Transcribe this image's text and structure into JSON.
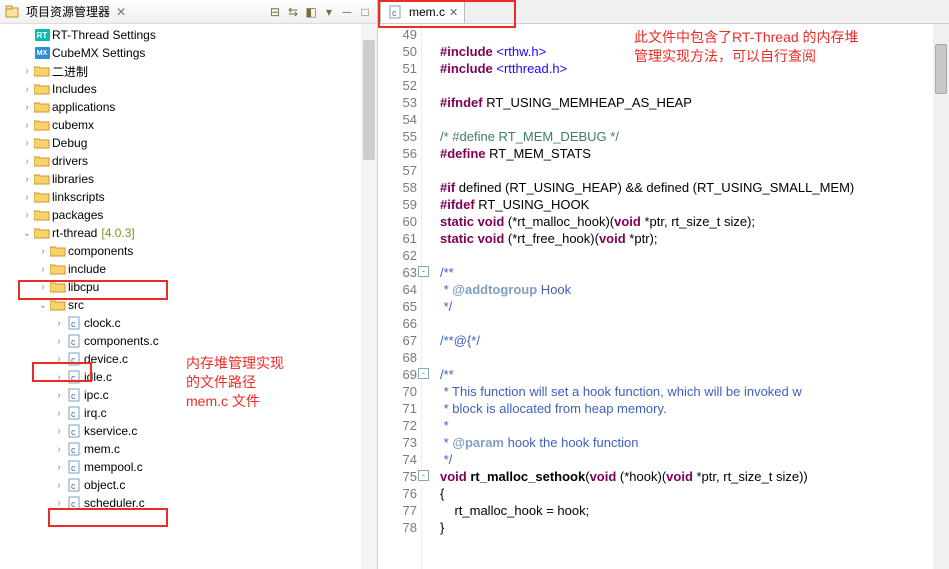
{
  "explorer": {
    "title": "项目资源管理器",
    "nodes": {
      "rt_settings": "RT-Thread Settings",
      "cubemx_settings": "CubeMX Settings",
      "binary": "二进制",
      "includes": "Includes",
      "applications": "applications",
      "cubemx": "cubemx",
      "debug": "Debug",
      "drivers": "drivers",
      "libraries": "libraries",
      "linkscripts": "linkscripts",
      "packages": "packages",
      "rtthread": "rt-thread",
      "rtthread_ver": "[4.0.3]",
      "components": "components",
      "include": "include",
      "libcpu": "libcpu",
      "src": "src",
      "clock": "clock.c",
      "componentsc": "components.c",
      "device": "device.c",
      "idle": "idle.c",
      "ipc": "ipc.c",
      "irq": "irq.c",
      "kservice": "kservice.c",
      "mem": "mem.c",
      "mempool": "mempool.c",
      "object": "object.c",
      "scheduler": "scheduler.c"
    }
  },
  "annot": {
    "tree_note_l1": "内存堆管理实现",
    "tree_note_l2": "的文件路径",
    "tree_note_l3": "mem.c 文件",
    "editor_note_l1": "此文件中包含了RT-Thread 的内存堆",
    "editor_note_l2": "管理实现方法，可以自行查阅"
  },
  "tab": {
    "filename": "mem.c"
  },
  "code": {
    "lines": [
      {
        "n": 49,
        "t": ""
      },
      {
        "n": 50,
        "pre": "#include",
        "arg": "<rthw.h>"
      },
      {
        "n": 51,
        "pre": "#include",
        "arg": "<rtthread.h>"
      },
      {
        "n": 52,
        "t": ""
      },
      {
        "n": 53,
        "pre": "#ifndef",
        "rest": " RT_USING_MEMHEAP_AS_HEAP"
      },
      {
        "n": 54,
        "t": ""
      },
      {
        "n": 55,
        "cmt": "/* #define RT_MEM_DEBUG */"
      },
      {
        "n": 56,
        "pre": "#define",
        "rest": " RT_MEM_STATS"
      },
      {
        "n": 57,
        "t": ""
      },
      {
        "n": 58,
        "pre": "#if",
        "rest": " defined (RT_USING_HEAP) && defined (RT_USING_SMALL_MEM)"
      },
      {
        "n": 59,
        "pre": "#ifdef",
        "rest": " RT_USING_HOOK"
      },
      {
        "n": 60,
        "sig": {
          "p1": "static void",
          "mid": " (*rt_malloc_hook)(",
          "p2": "void",
          "tail": " *ptr, rt_size_t size);"
        }
      },
      {
        "n": 61,
        "sig": {
          "p1": "static void",
          "mid": " (*rt_free_hook)(",
          "p2": "void",
          "tail": " *ptr);"
        }
      },
      {
        "n": 62,
        "t": ""
      },
      {
        "n": 63,
        "fold": "-",
        "doc": "/**"
      },
      {
        "n": 64,
        "docpre": " * ",
        "tag": "@addtogroup",
        "doctail": " Hook"
      },
      {
        "n": 65,
        "doc": " */"
      },
      {
        "n": 66,
        "t": ""
      },
      {
        "n": 67,
        "doc": "/**@{*/"
      },
      {
        "n": 68,
        "t": ""
      },
      {
        "n": 69,
        "fold": "-",
        "doc": "/**"
      },
      {
        "n": 70,
        "doc": " * This function will set a hook function, which will be invoked w"
      },
      {
        "n": 71,
        "doc": " * block is allocated from heap memory."
      },
      {
        "n": 72,
        "doc": " *"
      },
      {
        "n": 73,
        "docpre": " * ",
        "tag": "@param",
        "doctail": " hook the hook function"
      },
      {
        "n": 74,
        "doc": " */"
      },
      {
        "n": 75,
        "fold": "-",
        "fndef": {
          "a": "void ",
          "fn": "rt_malloc_sethook",
          "b": "(",
          "c": "void",
          "d": " (*hook)(",
          "e": "void",
          "f": " *ptr, rt_size_t size))"
        }
      },
      {
        "n": 76,
        "t": "{"
      },
      {
        "n": 77,
        "t": "    rt_malloc_hook = hook;"
      },
      {
        "n": 78,
        "t": "}"
      }
    ]
  }
}
